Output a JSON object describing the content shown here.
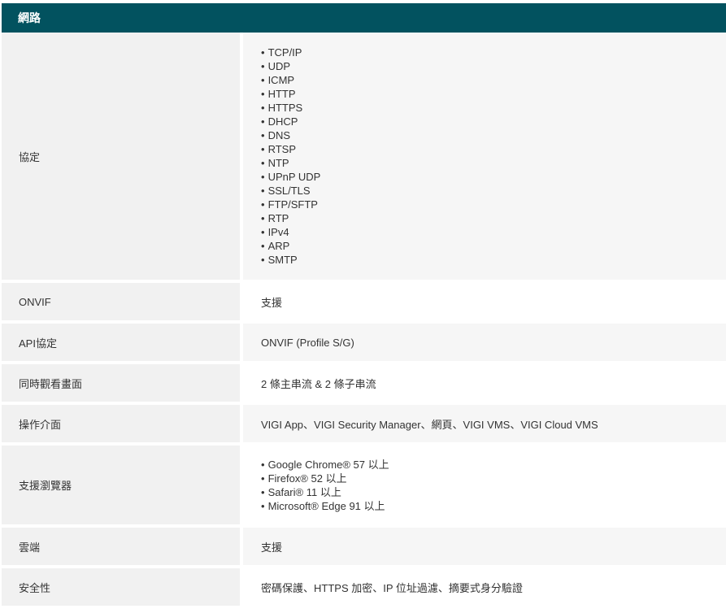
{
  "section": {
    "title": "網路"
  },
  "rows": [
    {
      "label": "協定",
      "items": [
        "TCP/IP",
        "UDP",
        "ICMP",
        "HTTP",
        "HTTPS",
        "DHCP",
        "DNS",
        "RTSP",
        "NTP",
        "UPnP UDP",
        "SSL/TLS",
        "FTP/SFTP",
        "RTP",
        "IPv4",
        "ARP",
        "SMTP"
      ]
    },
    {
      "label": "ONVIF",
      "value": "支援"
    },
    {
      "label": "API協定",
      "value": "ONVIF (Profile S/G)"
    },
    {
      "label": "同時觀看畫面",
      "value": "2 條主串流 & 2 條子串流"
    },
    {
      "label": "操作介面",
      "value": "VIGI App、VIGI Security Manager、網頁、VIGI VMS、VIGI Cloud VMS"
    },
    {
      "label": "支援瀏覽器",
      "items": [
        "Google Chrome® 57 以上",
        "Firefox® 52 以上",
        "Safari® 11 以上",
        "Microsoft® Edge 91 以上"
      ]
    },
    {
      "label": "雲端",
      "value": "支援"
    },
    {
      "label": "安全性",
      "value": "密碼保護、HTTPS 加密、IP 位址過濾、摘要式身分驗證"
    }
  ],
  "colors": {
    "header_bg": "#02525f",
    "header_text": "#ffffff",
    "label_bg": "#f1f1f1",
    "alt_value_bg": "#f6f6f6",
    "text": "#333333"
  }
}
